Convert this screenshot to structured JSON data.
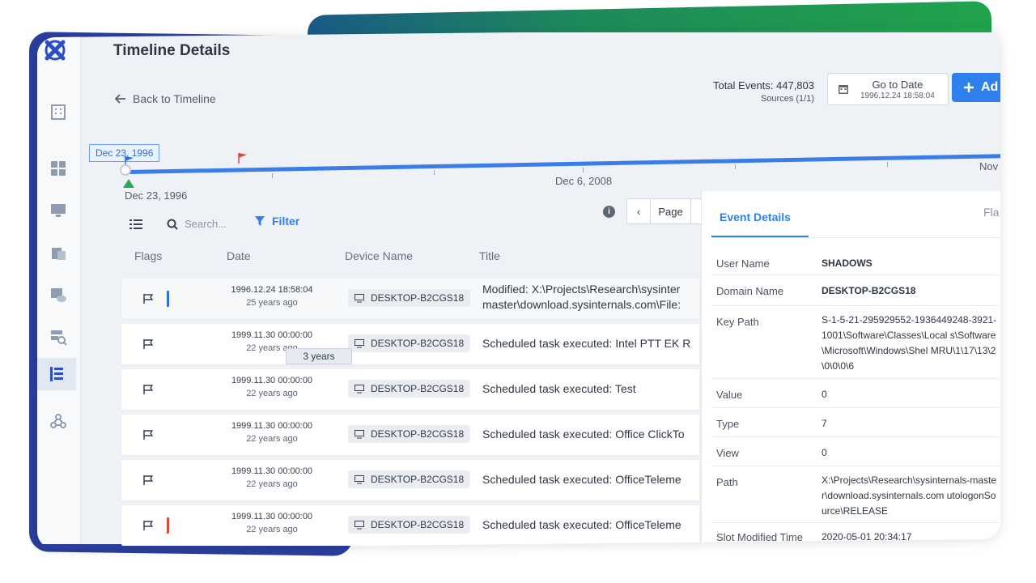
{
  "page": {
    "title": "Timeline Details",
    "back_label": "Back to Timeline"
  },
  "header": {
    "total_events": "Total Events: 447,803",
    "sources": "Sources (1/1)",
    "goto_label": "Go to Date",
    "goto_date": "1996.12.24 18:58:04",
    "add_label": "Ad"
  },
  "timeline": {
    "start_tag": "Dec 23, 1996",
    "start_label": "Dec 23, 1996",
    "mid_label": "Dec 6, 2008",
    "end_label": "Nov"
  },
  "toolbar": {
    "search_placeholder": "Search...",
    "filter_label": "Filter",
    "info": "i",
    "page_label": "Page",
    "prev": "‹",
    "next": "›"
  },
  "table": {
    "headers": {
      "flags": "Flags",
      "date": "Date",
      "device": "Device Name",
      "title": "Title"
    },
    "tooltip": "3 years",
    "rows": [
      {
        "date": "1996.12.24 18:58:04",
        "ago": "25 years ago",
        "device": "DESKTOP-B2CGS18",
        "title_line1": "Modified: X:\\Projects\\Research\\sysinter",
        "title_line2": "master\\download.sysinternals.com\\File:",
        "bar_color": "#2f6fe4"
      },
      {
        "date": "1999.11.30 00:00:00",
        "ago": "22 years ago",
        "device": "DESKTOP-B2CGS18",
        "title_line1": "Scheduled task executed: Intel PTT EK R",
        "title_line2": "",
        "bar_color": ""
      },
      {
        "date": "1999.11.30 00:00:00",
        "ago": "22 years ago",
        "device": "DESKTOP-B2CGS18",
        "title_line1": "Scheduled task executed: Test",
        "title_line2": "",
        "bar_color": ""
      },
      {
        "date": "1999.11.30 00:00:00",
        "ago": "22 years ago",
        "device": "DESKTOP-B2CGS18",
        "title_line1": "Scheduled task executed: Office ClickTo",
        "title_line2": "",
        "bar_color": ""
      },
      {
        "date": "1999.11.30 00:00:00",
        "ago": "22 years ago",
        "device": "DESKTOP-B2CGS18",
        "title_line1": "Scheduled task executed: OfficeTeleme",
        "title_line2": "",
        "bar_color": ""
      },
      {
        "date": "1999.11.30 00:00:00",
        "ago": "22 years ago",
        "device": "DESKTOP-B2CGS18",
        "title_line1": "Scheduled task executed: OfficeTeleme",
        "title_line2": "",
        "bar_color": "#e5483a"
      }
    ]
  },
  "details": {
    "tab_active": "Event Details",
    "tab_other": "Fla",
    "fields": [
      {
        "key": "User Name",
        "value": "SHADOWS"
      },
      {
        "key": "Domain Name",
        "value": "DESKTOP-B2CGS18"
      },
      {
        "key": "Key Path",
        "value": "S-1-5-21-295929552-1936449248-3921-1001\\Software\\Classes\\Local s\\Software\\Microsoft\\Windows\\Shel MRU\\1\\17\\13\\2\\0\\0\\0\\6"
      },
      {
        "key": "Value",
        "value": "0"
      },
      {
        "key": "Type",
        "value": "7"
      },
      {
        "key": "View",
        "value": "0"
      },
      {
        "key": "Path",
        "value": "X:\\Projects\\Research\\sysinternals-master\\download.sysinternals.com utologonSource\\RELEASE"
      },
      {
        "key": "Slot Modified Time",
        "value": "2020-05-01 20:34:17"
      }
    ]
  },
  "colors": {
    "accent": "#2f80ed",
    "green": "#2eaa56",
    "flag_red": "#e5483a",
    "flag_blue": "#2f6fe4"
  },
  "icons": [
    "logo-icon",
    "building-icon",
    "dashboard-icon",
    "monitor-icon",
    "case-icon",
    "cloud-icon",
    "search-server-icon",
    "timeline-icon",
    "network-icon"
  ]
}
